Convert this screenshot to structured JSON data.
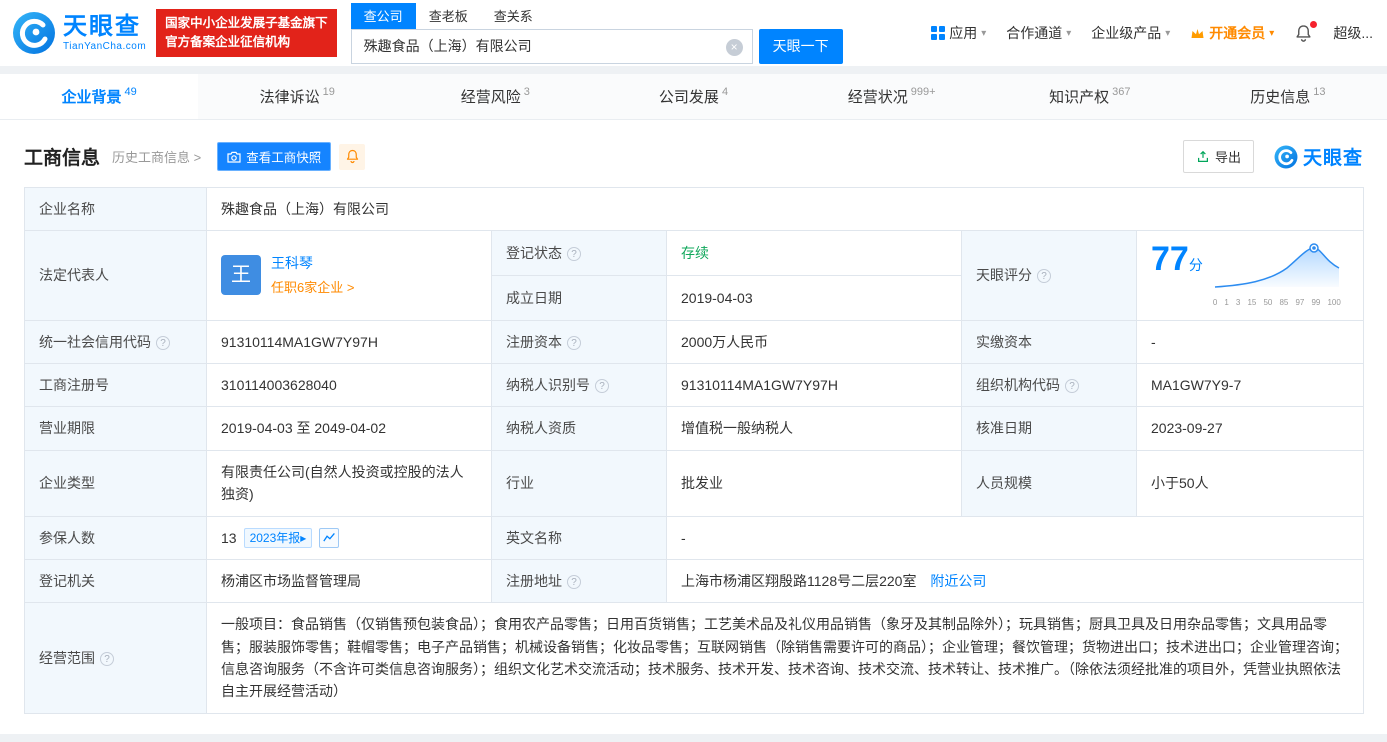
{
  "icons": {
    "chevron_down": "▾",
    "caret_right": "▸",
    "help": "?",
    "clear": "×"
  },
  "header": {
    "logo": {
      "title": "天眼查",
      "subtitle": "TianYanCha.com"
    },
    "badge": {
      "line1": "国家中小企业发展子基金旗下",
      "line2": "官方备案企业征信机构"
    },
    "search_tabs": [
      {
        "label": "查公司"
      },
      {
        "label": "查老板"
      },
      {
        "label": "查关系"
      }
    ],
    "search": {
      "value": "殊趣食品（上海）有限公司",
      "button": "天眼一下"
    },
    "nav": [
      {
        "label": "应用"
      },
      {
        "label": "合作通道"
      },
      {
        "label": "企业级产品"
      },
      {
        "label": "开通会员"
      },
      {
        "label": "超级..."
      }
    ]
  },
  "tabs": [
    {
      "label": "企业背景",
      "count": "49"
    },
    {
      "label": "法律诉讼",
      "count": "19"
    },
    {
      "label": "经营风险",
      "count": "3"
    },
    {
      "label": "公司发展",
      "count": "4"
    },
    {
      "label": "经营状况",
      "count": "999+"
    },
    {
      "label": "知识产权",
      "count": "367"
    },
    {
      "label": "历史信息",
      "count": "13"
    }
  ],
  "section": {
    "title": "工商信息",
    "history_link": "历史工商信息 >",
    "snapshot_button": "查看工商快照",
    "export_button": "导出",
    "brand": "天眼查"
  },
  "biz": {
    "company_name": {
      "label": "企业名称",
      "value": "殊趣食品（上海）有限公司"
    },
    "legal_rep": {
      "label": "法定代表人",
      "avatar": "王",
      "name": "王科琴",
      "link": "任职6家企业 >"
    },
    "reg_status": {
      "label": "登记状态",
      "value": "存续"
    },
    "est_date": {
      "label": "成立日期",
      "value": "2019-04-03"
    },
    "score": {
      "label": "天眼评分",
      "value": "77",
      "unit": "分",
      "axis": [
        "0",
        "1",
        "3",
        "15",
        "50",
        "85",
        "97",
        "99",
        "100"
      ]
    },
    "credit_code": {
      "label": "统一社会信用代码",
      "value": "91310114MA1GW7Y97H"
    },
    "reg_capital": {
      "label": "注册资本",
      "value": "2000万人民币"
    },
    "paid_capital": {
      "label": "实缴资本",
      "value": "-"
    },
    "reg_number": {
      "label": "工商注册号",
      "value": "310114003628040"
    },
    "taxpayer_id": {
      "label": "纳税人识别号",
      "value": "91310114MA1GW7Y97H"
    },
    "org_code": {
      "label": "组织机构代码",
      "value": "MA1GW7Y9-7"
    },
    "term": {
      "label": "营业期限",
      "value": "2019-04-03 至 2049-04-02"
    },
    "taxpayer_quality": {
      "label": "纳税人资质",
      "value": "增值税一般纳税人"
    },
    "approval_date": {
      "label": "核准日期",
      "value": "2023-09-27"
    },
    "company_type": {
      "label": "企业类型",
      "value": "有限责任公司(自然人投资或控股的法人独资)"
    },
    "industry": {
      "label": "行业",
      "value": "批发业"
    },
    "staff_size": {
      "label": "人员规模",
      "value": "小于50人"
    },
    "insured": {
      "label": "参保人数",
      "value": "13",
      "tag": "2023年报"
    },
    "english_name": {
      "label": "英文名称",
      "value": "-"
    },
    "authority": {
      "label": "登记机关",
      "value": "杨浦区市场监督管理局"
    },
    "address": {
      "label": "注册地址",
      "value": "上海市杨浦区翔殷路1128号二层220室",
      "link": "附近公司"
    },
    "scope": {
      "label": "经营范围",
      "value": "一般项目：食品销售（仅销售预包装食品）；食用农产品零售；日用百货销售；工艺美术品及礼仪用品销售（象牙及其制品除外）；玩具销售；厨具卫具及日用杂品零售；文具用品零售；服装服饰零售；鞋帽零售；电子产品销售；机械设备销售；化妆品零售；互联网销售（除销售需要许可的商品）；企业管理；餐饮管理；货物进出口；技术进出口；企业管理咨询；信息咨询服务（不含许可类信息咨询服务）；组织文化艺术交流活动；技术服务、技术开发、技术咨询、技术交流、技术转让、技术推广。（除依法须经批准的项目外，凭营业执照依法自主开展经营活动）"
    }
  }
}
